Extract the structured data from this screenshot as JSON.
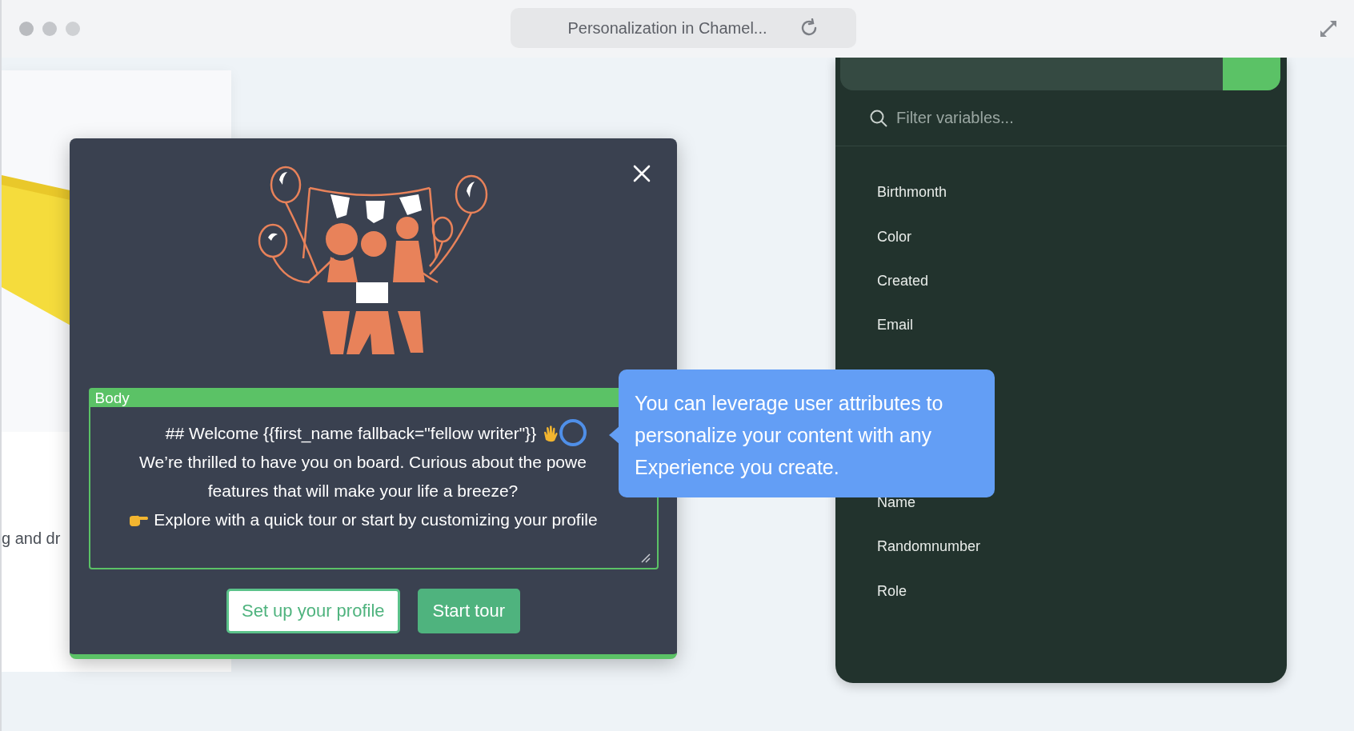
{
  "window": {
    "title": "Personalization in Chamel..."
  },
  "background": {
    "snippet": "g and dr"
  },
  "modal": {
    "body_label": "Body",
    "body_lines": [
      {
        "text": "## Welcome {{first_name fallback=\"fellow writer\"}}",
        "kind": "heading"
      },
      {
        "text": "We’re thrilled to have you on board. Curious about the powe",
        "kind": "plain"
      },
      {
        "text": "features that will make your life a breeze?",
        "kind": "plain"
      },
      {
        "text": "Explore with a quick tour or start by customizing your profile",
        "kind": "bullet"
      }
    ],
    "buttons": [
      {
        "label": "Set up your profile",
        "kind": "secondary"
      },
      {
        "label": "Start tour",
        "kind": "primary"
      }
    ]
  },
  "tooltip": {
    "text": "You can leverage user attributes to personalize your content with any Experience you create."
  },
  "variables_panel": {
    "search": {
      "placeholder": "Filter variables..."
    },
    "items_above_tooltip": [
      {
        "label": "Birthmonth"
      },
      {
        "label": "Color"
      },
      {
        "label": "Created"
      },
      {
        "label": "Email"
      }
    ],
    "items_below_tooltip": [
      {
        "label": "Name"
      },
      {
        "label": "Randomnumber"
      },
      {
        "label": "Role"
      }
    ]
  }
}
